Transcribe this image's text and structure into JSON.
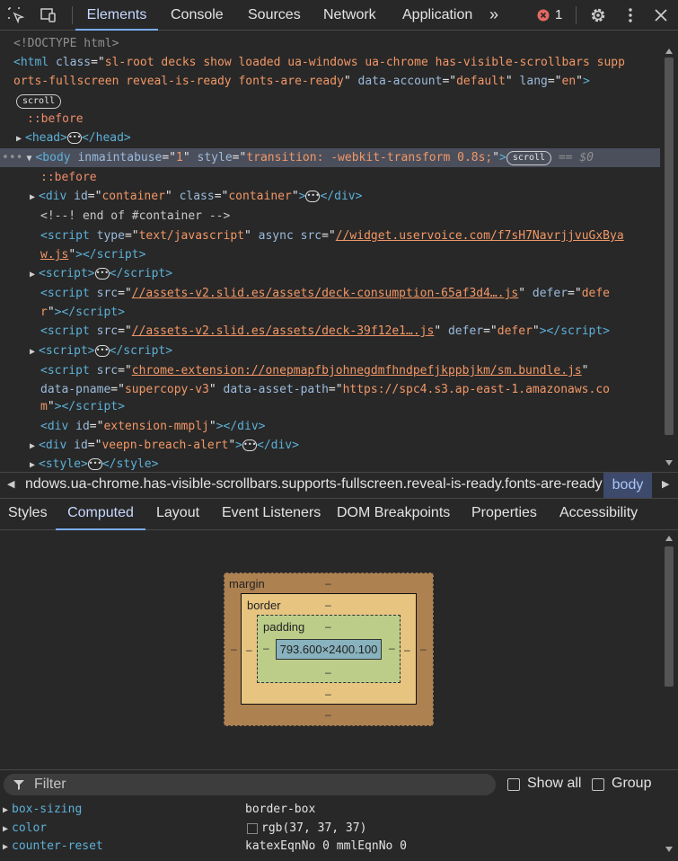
{
  "toolbar": {
    "tabs": [
      "Elements",
      "Console",
      "Sources",
      "Network",
      "Application"
    ],
    "more": "»",
    "error_count": "1"
  },
  "dom": {
    "doctype": "<!DOCTYPE html>",
    "html_open_1": "sl-root decks show loaded ua-windows ua-chrome has-visible-scrollbars supp",
    "html_open_2": "orts-fullscreen reveal-is-ready fonts-are-ready",
    "html_data_account": "default",
    "html_lang": "en",
    "scroll_badge": "scroll",
    "before": "::before",
    "head": "head",
    "body_inmaintabuse": "1",
    "body_style": "transition: -webkit-transform 0.8s;",
    "dollar0": "== $0",
    "container_id": "container",
    "container_class": "container",
    "comment": "<!--! end of #container -->",
    "script1_type": "text/javascript",
    "script1_src_1": "//widget.uservoice.com/f7sH7NavrjjvuGxBya",
    "script1_src_2": "w.js",
    "script2_src": "//assets-v2.slid.es/assets/deck-consumption-65af3d4….js",
    "script2_defer_1": "defe",
    "script2_defer_2": "r",
    "script3_src": "//assets-v2.slid.es/assets/deck-39f12e1….js",
    "script3_defer": "defer",
    "script4_src": "chrome-extension://onepmapfbjohnegdmfhndpefjkppbjkm/sm.bundle.js",
    "script4_pname": "supercopy-v3",
    "script4_asset_1": "https://spc4.s3.ap-east-1.amazonaws.co",
    "script4_asset_2": "m",
    "ext_id": "extension-mmplj",
    "veepn_id": "veepn-breach-alert"
  },
  "breadcrumb": {
    "path": "ndows.ua-chrome.has-visible-scrollbars.supports-fullscreen.reveal-is-ready.fonts-are-ready",
    "current": "body"
  },
  "subtabs": [
    "Styles",
    "Computed",
    "Layout",
    "Event Listeners",
    "DOM Breakpoints",
    "Properties",
    "Accessibility"
  ],
  "boxmodel": {
    "margin_label": "margin",
    "border_label": "border",
    "padding_label": "padding",
    "content": "793.600×2400.100",
    "dash": "–"
  },
  "filter": {
    "placeholder": "Filter",
    "show_all": "Show all",
    "group": "Group"
  },
  "properties": [
    {
      "name": "box-sizing",
      "value": "border-box"
    },
    {
      "name": "color",
      "value": "rgb(37, 37, 37)"
    },
    {
      "name": "counter-reset",
      "value": "katexEqnNo 0 mmlEqnNo 0"
    }
  ],
  "colors": {
    "accent": "#7cacf8",
    "margin": "#ae8151",
    "border": "#e7c480",
    "padding": "#bccd8a",
    "content": "#88b2bd",
    "error": "#e46962"
  }
}
